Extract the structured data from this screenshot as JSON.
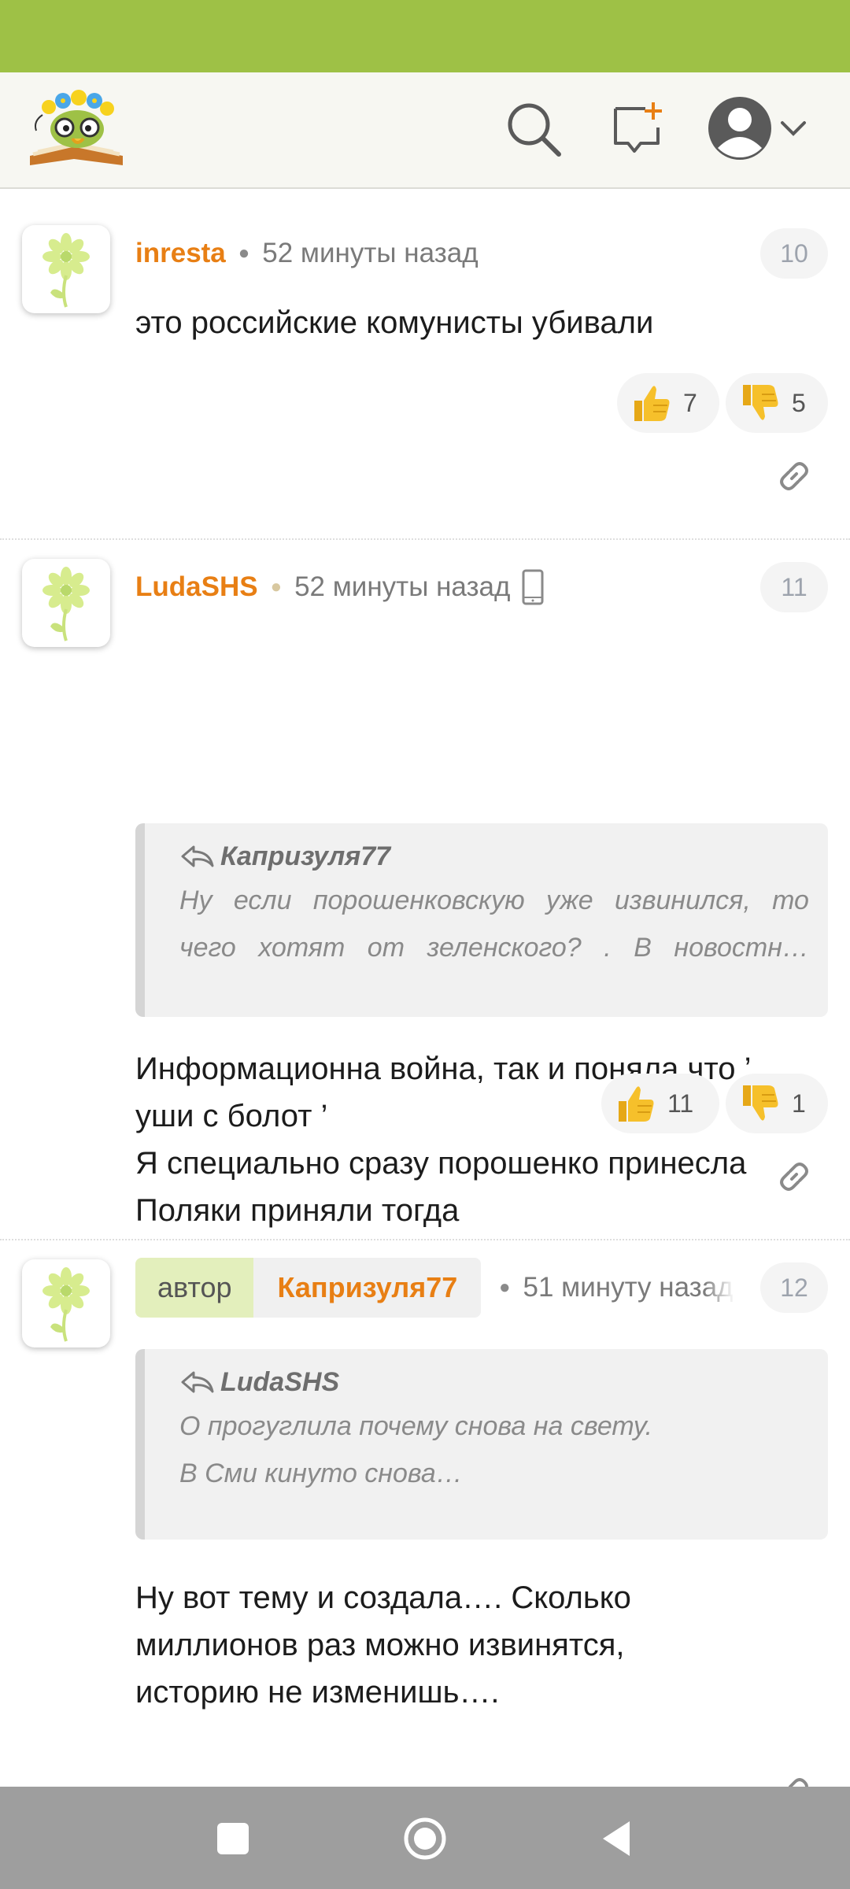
{
  "header": {
    "logo_name": "site-logo",
    "icons": [
      "search-icon",
      "new-message-icon",
      "user-avatar-icon",
      "chevron-down-icon"
    ]
  },
  "comments": [
    {
      "username": "inresta",
      "time": "52 минуты назад",
      "number": "10",
      "text": "это российские комунисты убивали",
      "likes": "7",
      "dislikes": "5"
    },
    {
      "username": "LudaSHS",
      "time": "52 минуты назад",
      "number": "11",
      "quote": {
        "author": "Капризуля77",
        "line1_words": [
          "Ну",
          "если",
          "порошенковскую",
          "уже",
          "извинился,",
          "то"
        ],
        "line2_words": [
          "чего",
          "хотят",
          "от",
          "зеленского?",
          ".",
          "В",
          "новостн…"
        ]
      },
      "text_lines": [
        "Информационна война, так и поняла что ’",
        "уши с болот ’",
        "Я специально сразу порошенко принесла",
        "Поляки приняли тогда"
      ],
      "likes": "11",
      "dislikes": "1"
    },
    {
      "author_label": "автор",
      "username": "Капризуля77",
      "time": "51 минуту назад",
      "number": "12",
      "quote": {
        "author": "LudaSHS",
        "line1": "О прогуглила почему снова на свету.",
        "line2": "В Сми кинуто снова…"
      },
      "text_lines": [
        "Ну вот тему и создала…. Сколько",
        "миллионов раз можно извинятся,",
        "историю не изменишь…."
      ]
    }
  ],
  "colors": {
    "status_bar": "#9ec146",
    "username": "#e87f14",
    "author_tag": "#e3efbc",
    "nav_bar": "#9e9e9e"
  }
}
